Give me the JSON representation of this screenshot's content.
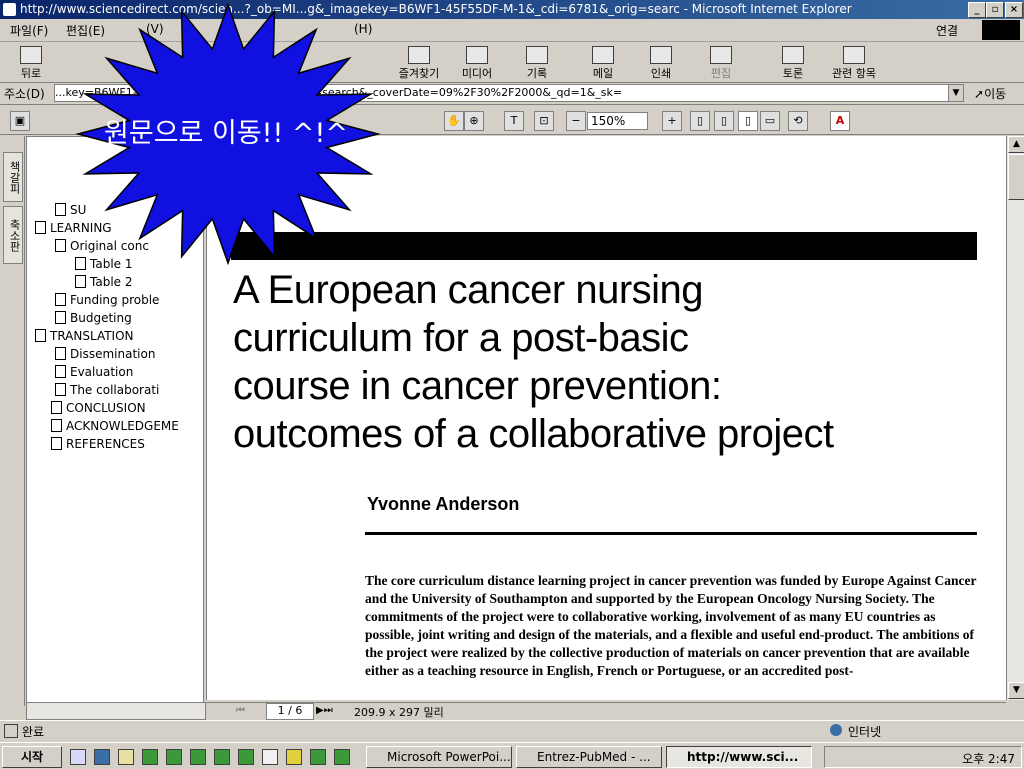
{
  "window": {
    "title": "http://www.sciencedirect.com/scien...?_ob=MI...g&_imagekey=B6WF1-45F55DF-M-1&_cdi=6781&_orig=searc - Microsoft Internet Explorer"
  },
  "menu": {
    "items": [
      "파일(F)",
      "편집(E)",
      "(V)",
      "(H)"
    ],
    "connect_label": "연결"
  },
  "toolbar": {
    "back": "뒤로",
    "refresh": "즐겨찾기",
    "media": "미디어",
    "history": "기록",
    "mail": "메일",
    "print": "인쇄",
    "edit": "편집",
    "discuss": "토론",
    "related": "관련 항목"
  },
  "address": {
    "label": "주소(D)",
    "value": "...key=B6WF1-45F55DF-M-1&_cdi=6781&_orig=search&_coverDate=09%2F30%2F2000&_qd=1&_sk=",
    "go": "이동"
  },
  "pdf": {
    "zoom": "150%",
    "page": "1 / 6",
    "size": "209.9 x 297 밀리"
  },
  "lefttabs": {
    "tab1": "책갈피",
    "tab2": "축소판"
  },
  "bookmarks": [
    {
      "label": "SU",
      "level": 1
    },
    {
      "label": "LEARNING",
      "level": 0
    },
    {
      "label": "Original conc",
      "level": 1
    },
    {
      "label": "Table 1",
      "level": 2
    },
    {
      "label": "Table 2",
      "level": 2
    },
    {
      "label": "Funding proble",
      "level": 1
    },
    {
      "label": "Budgeting",
      "level": 1
    },
    {
      "label": "TRANSLATION",
      "level": 0
    },
    {
      "label": "Dissemination",
      "level": 1
    },
    {
      "label": "Evaluation",
      "level": 1
    },
    {
      "label": "The collaborati",
      "level": 1
    },
    {
      "label": "CONCLUSION",
      "level": 0
    },
    {
      "label": "ACKNOWLEDGEME",
      "level": 0
    },
    {
      "label": "REFERENCES",
      "level": 0
    }
  ],
  "article": {
    "title_lines": [
      "A European cancer nursing",
      "curriculum for a post-basic",
      "course in cancer prevention:",
      "outcomes of a collaborative project"
    ],
    "author": "Yvonne Anderson",
    "abstract": "The core curriculum distance learning project in cancer prevention was funded by Europe Against Cancer and the University of Southampton and supported by the European Oncology Nursing Society. The commitments of the project were to collaborative working, involvement of as many EU countries as possible, joint writing and design of the materials, and a flexible and useful end-product. The ambitions of the project were realized by the collective production of materials on cancer prevention that are available either as a teaching resource in English, French or Portuguese, or an accredited post-"
  },
  "callout": {
    "text": "원문으로 이동!! ^!^"
  },
  "status": {
    "left": "완료",
    "zone": "인터넷"
  },
  "taskbar": {
    "start": "시작",
    "tasks": [
      "Microsoft PowerPoi...",
      "Entrez-PubMed - ...",
      "http://www.sci..."
    ],
    "clock": "오후 2:47"
  }
}
